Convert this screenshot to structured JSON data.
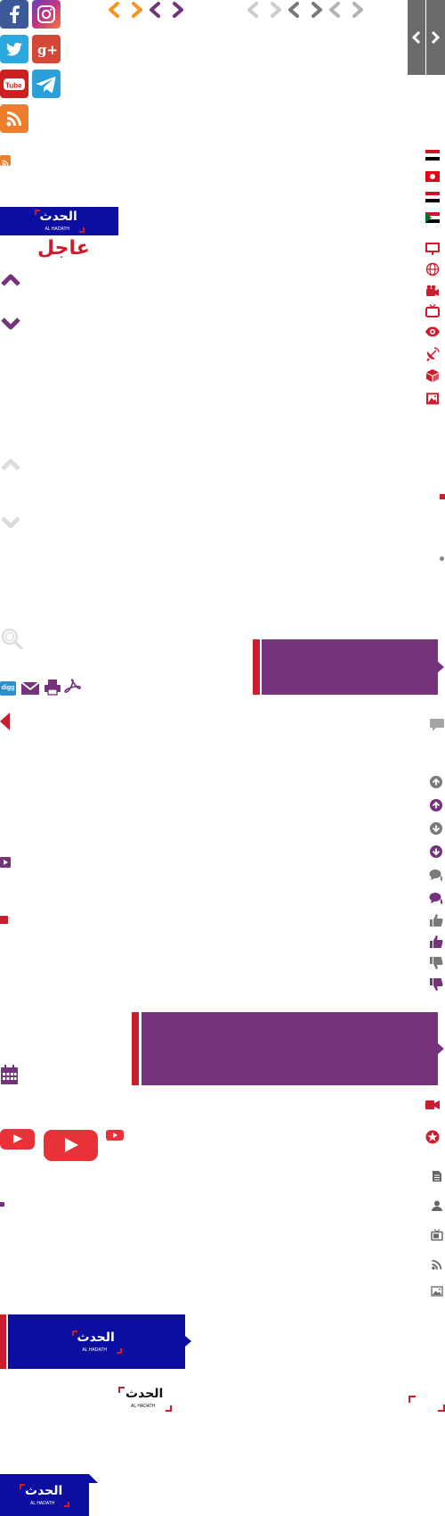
{
  "breaking": {
    "label": "عاجل"
  },
  "logo": {
    "text": "الحدث",
    "subtitle": "AL HADATH"
  },
  "social": [
    "instagram-icon",
    "facebook-icon",
    "google-plus-icon",
    "twitter-icon",
    "telegram-icon",
    "youtube-icon",
    "rss-icon"
  ],
  "share": [
    "pdf-icon",
    "print-icon",
    "email-icon",
    "digg-icon"
  ],
  "colors": {
    "brand_purple": "#74337b",
    "brand_red": "#cc1d2e",
    "brand_blue": "#0b0e9e",
    "accent_orange": "#f7941d",
    "grey": "#777777"
  }
}
